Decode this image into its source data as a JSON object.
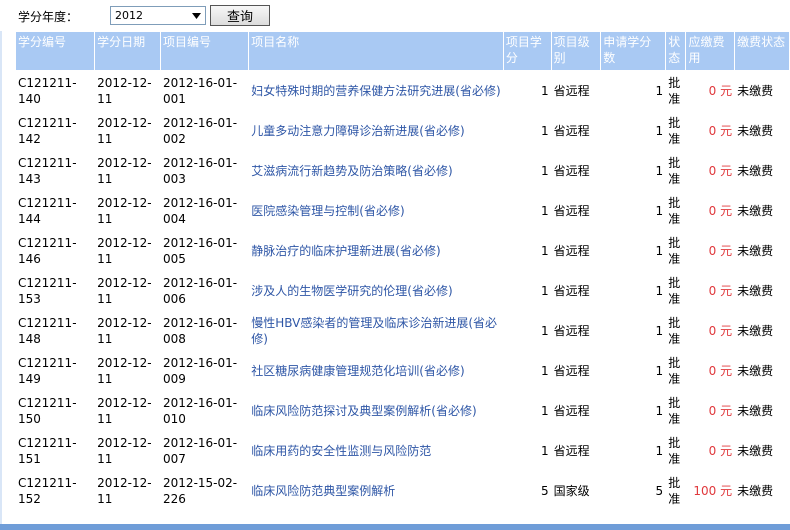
{
  "filter": {
    "year_label": "学分年度：",
    "year_value": "2012",
    "query_label": "查询"
  },
  "table": {
    "headers": {
      "code": "学分编号",
      "date": "学分日期",
      "project_no": "项目编号",
      "project_name": "项目名称",
      "project_credit": "项目学分",
      "level": "项目级别",
      "req_credit": "申请学分数",
      "status": "状态",
      "fee": "应缴费用",
      "pay_status": "缴费状态"
    },
    "rows": [
      {
        "code": "C121211-140",
        "date": "2012-12-11",
        "project_no": "2012-16-01-001",
        "name": "妇女特殊时期的营养保健方法研究进展(省必修)",
        "credit": "1",
        "level": "省远程",
        "req": "1",
        "status": "批准",
        "fee": "0 元",
        "pay": "未缴费"
      },
      {
        "code": "C121211-142",
        "date": "2012-12-11",
        "project_no": "2012-16-01-002",
        "name": "儿童多动注意力障碍诊治新进展(省必修)",
        "credit": "1",
        "level": "省远程",
        "req": "1",
        "status": "批准",
        "fee": "0 元",
        "pay": "未缴费"
      },
      {
        "code": "C121211-143",
        "date": "2012-12-11",
        "project_no": "2012-16-01-003",
        "name": "艾滋病流行新趋势及防治策略(省必修)",
        "credit": "1",
        "level": "省远程",
        "req": "1",
        "status": "批准",
        "fee": "0 元",
        "pay": "未缴费"
      },
      {
        "code": "C121211-144",
        "date": "2012-12-11",
        "project_no": "2012-16-01-004",
        "name": "医院感染管理与控制(省必修)",
        "credit": "1",
        "level": "省远程",
        "req": "1",
        "status": "批准",
        "fee": "0 元",
        "pay": "未缴费"
      },
      {
        "code": "C121211-146",
        "date": "2012-12-11",
        "project_no": "2012-16-01-005",
        "name": "静脉治疗的临床护理新进展(省必修)",
        "credit": "1",
        "level": "省远程",
        "req": "1",
        "status": "批准",
        "fee": "0 元",
        "pay": "未缴费"
      },
      {
        "code": "C121211-153",
        "date": "2012-12-11",
        "project_no": "2012-16-01-006",
        "name": "涉及人的生物医学研究的伦理(省必修)",
        "credit": "1",
        "level": "省远程",
        "req": "1",
        "status": "批准",
        "fee": "0 元",
        "pay": "未缴费"
      },
      {
        "code": "C121211-148",
        "date": "2012-12-11",
        "project_no": "2012-16-01-008",
        "name": "慢性HBV感染者的管理及临床诊治新进展(省必修)",
        "credit": "1",
        "level": "省远程",
        "req": "1",
        "status": "批准",
        "fee": "0 元",
        "pay": "未缴费"
      },
      {
        "code": "C121211-149",
        "date": "2012-12-11",
        "project_no": "2012-16-01-009",
        "name": "社区糖尿病健康管理规范化培训(省必修)",
        "credit": "1",
        "level": "省远程",
        "req": "1",
        "status": "批准",
        "fee": "0 元",
        "pay": "未缴费"
      },
      {
        "code": "C121211-150",
        "date": "2012-12-11",
        "project_no": "2012-16-01-010",
        "name": "临床风险防范探讨及典型案例解析(省必修)",
        "credit": "1",
        "level": "省远程",
        "req": "1",
        "status": "批准",
        "fee": "0 元",
        "pay": "未缴费"
      },
      {
        "code": "C121211-151",
        "date": "2012-12-11",
        "project_no": "2012-16-01-007",
        "name": "临床用药的安全性监测与风险防范",
        "credit": "1",
        "level": "省远程",
        "req": "1",
        "status": "批准",
        "fee": "0 元",
        "pay": "未缴费"
      },
      {
        "code": "C121211-152",
        "date": "2012-12-11",
        "project_no": "2012-15-02-226",
        "name": "临床风险防范典型案例解析",
        "credit": "5",
        "level": "国家级",
        "req": "5",
        "status": "批准",
        "fee": "100 元",
        "pay": "未缴费"
      }
    ]
  }
}
